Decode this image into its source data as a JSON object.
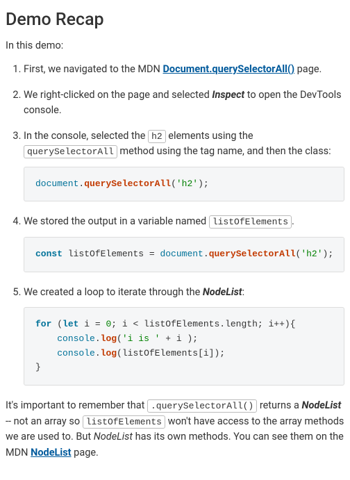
{
  "heading": "Demo Recap",
  "intro": "In this demo:",
  "steps": {
    "s1_a": "First, we navigated to the MDN ",
    "s1_link": "Document.querySelectorAll()",
    "s1_b": " page.",
    "s2_a": "We right-clicked on the page and selected ",
    "s2_em": "Inspect",
    "s2_b": " to open the DevTools console.",
    "s3_a": "In the console, selected the ",
    "s3_code1": "h2",
    "s3_b": " elements using the ",
    "s3_code2": "querySelectorAll",
    "s3_c": " method using the tag name, and then the class:",
    "s4_a": "We stored the output in a variable named ",
    "s4_code": "listOfElements",
    "s4_b": ".",
    "s5_a": "We created a loop to iterate through the ",
    "s5_em": "NodeList",
    "s5_b": ":"
  },
  "code1": {
    "doc": "document",
    "dot1": ".",
    "method": "querySelectorAll",
    "open": "(",
    "str": "'h2'",
    "close": ");"
  },
  "code2": {
    "kw": "const",
    "sp1": " ",
    "ident": "listOfElements",
    "eq": " = ",
    "doc": "document",
    "dot": ".",
    "method": "querySelectorAll",
    "open": "(",
    "str": "'h2'",
    "close": ");"
  },
  "code3": {
    "l1_for": "for",
    "l1_a": " (",
    "l1_let": "let",
    "l1_b": " i = ",
    "l1_zero": "0",
    "l1_c": "; i < listOfElements.length; i++){",
    "l2_pad": "    ",
    "l2_console": "console",
    "l2_dot": ".",
    "l2_log": "log",
    "l2_open": "(",
    "l2_str": "'i is '",
    "l2_rest": " + i );",
    "l3_pad": "    ",
    "l3_console": "console",
    "l3_dot": ".",
    "l3_log": "log",
    "l3_open": "(",
    "l3_arg": "listOfElements[i]",
    "l3_close": ");",
    "l4": "}"
  },
  "closing": {
    "a": "It's important to remember that ",
    "code1": ".querySelectorAll()",
    "b": " returns a ",
    "em1": "NodeList",
    "c": " -- not an array so ",
    "code2": "listOfElements",
    "d": " won't have access to the array methods we are used to. But ",
    "em2": "NodeList",
    "e": " has its own methods. You can see them on the MDN ",
    "link": "NodeList",
    "f": " page."
  },
  "links": {
    "qsa": "#",
    "nodelist": "#"
  }
}
